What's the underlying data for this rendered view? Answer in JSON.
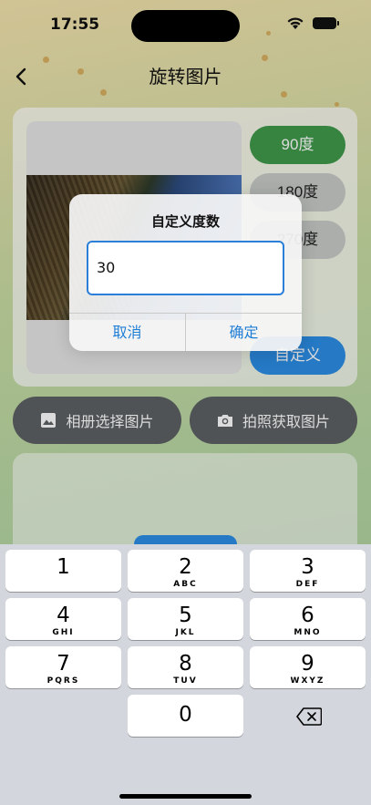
{
  "status_bar": {
    "time": "17:55"
  },
  "nav": {
    "title": "旋转图片"
  },
  "rotation_options": [
    {
      "label": "90度"
    },
    {
      "label": "180度"
    },
    {
      "label": "270度"
    },
    {
      "label": "自定义"
    }
  ],
  "actions": {
    "album_label": "相册选择图片",
    "camera_label": "拍照获取图片"
  },
  "dialog": {
    "title": "自定义度数",
    "input_value": "30",
    "cancel_label": "取消",
    "confirm_label": "确定"
  },
  "keypad": {
    "keys": [
      {
        "num": "1",
        "letters": ""
      },
      {
        "num": "2",
        "letters": "ABC"
      },
      {
        "num": "3",
        "letters": "DEF"
      },
      {
        "num": "4",
        "letters": "GHI"
      },
      {
        "num": "5",
        "letters": "JKL"
      },
      {
        "num": "6",
        "letters": "MNO"
      },
      {
        "num": "7",
        "letters": "PQRS"
      },
      {
        "num": "8",
        "letters": "TUV"
      },
      {
        "num": "9",
        "letters": "WXYZ"
      },
      {
        "num": "0",
        "letters": ""
      }
    ]
  },
  "colors": {
    "accent_green": "#3f9a4b",
    "accent_blue": "#2c8de6",
    "dialog_button": "#1f7ed6"
  }
}
